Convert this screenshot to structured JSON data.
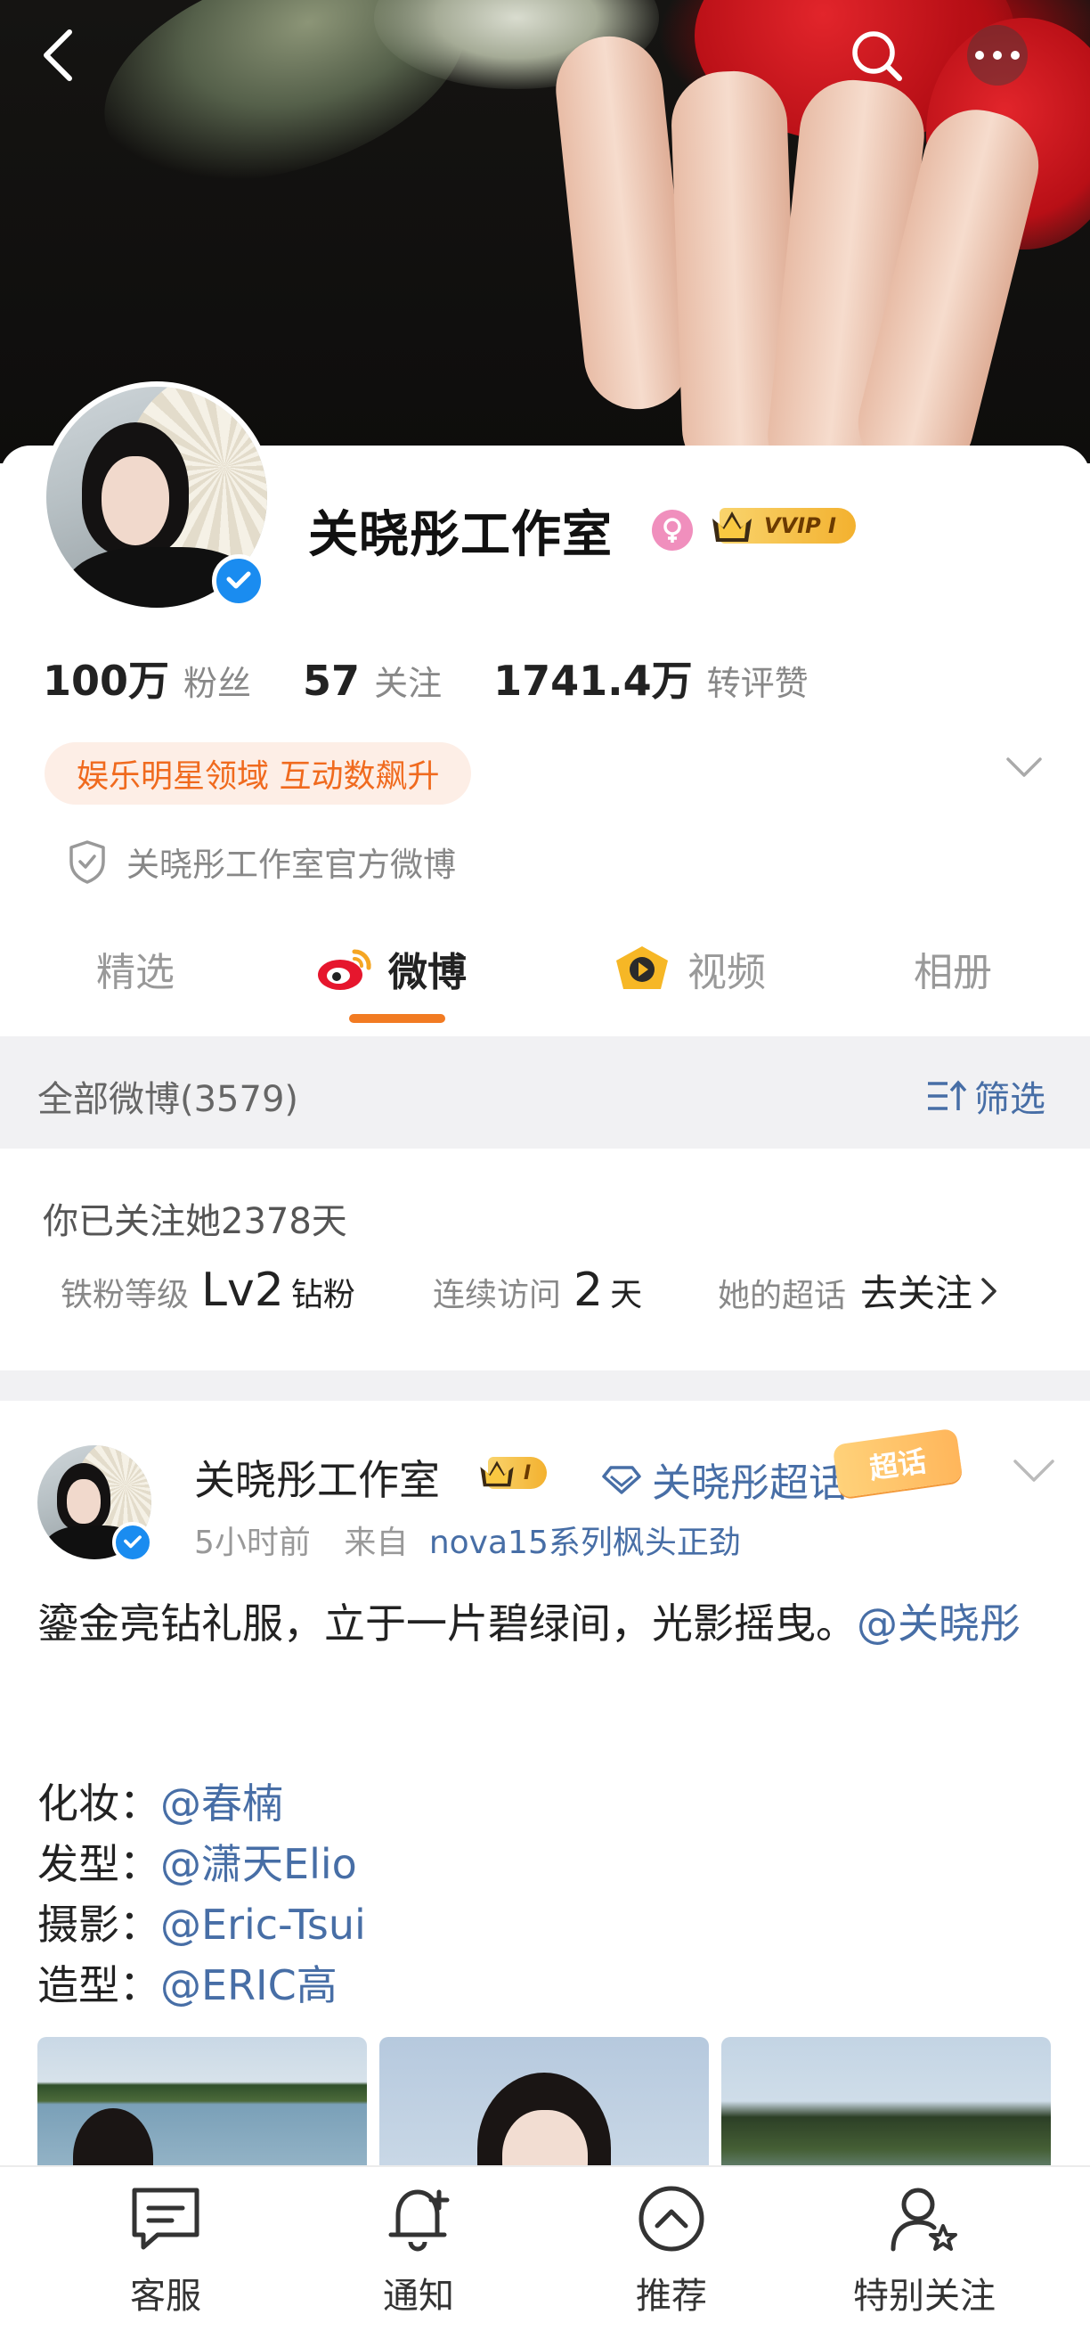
{
  "header": {
    "back_icon": "chevron-left-icon",
    "search_icon": "search-icon",
    "more_icon": "more-dots-icon"
  },
  "profile": {
    "name": "关晓彤工作室",
    "gender_icon": "female-icon",
    "vip_label": "VVIP I",
    "verified_icon": "verified-badge-icon",
    "stats": [
      {
        "value": "100万",
        "label": "粉丝"
      },
      {
        "value": "57",
        "label": "关注"
      },
      {
        "value": "1741.4万",
        "label": "转评赞"
      }
    ],
    "domain_tag": "娱乐明星领域 互动数飙升",
    "official_label": "关晓彤工作室官方微博"
  },
  "tabs": [
    {
      "label": "精选",
      "active": false
    },
    {
      "label": "微博",
      "active": true
    },
    {
      "label": "视频",
      "active": false
    },
    {
      "label": "相册",
      "active": false
    }
  ],
  "filter": {
    "all_posts": "全部微博(3579)",
    "filter_label": "筛选"
  },
  "follow_info": {
    "days_text": "你已关注她2378天",
    "fan_level_label": "铁粉等级",
    "fan_level_value": "Lv2",
    "fan_level_suffix": "钻粉",
    "visit_label": "连续访问",
    "visit_value": "2",
    "visit_suffix": "天",
    "super_label": "她的超话",
    "super_action": "去关注"
  },
  "post": {
    "author": "关晓彤工作室",
    "vip_label": "I",
    "super_topic": "关晓彤超话",
    "super_badge": "超话",
    "time": "5小时前",
    "from_prefix": "来自",
    "source": "nova15系列枫头正劲",
    "text": "鎏金亮钻礼服，立于一片碧绿间，光影摇曳。",
    "mention": "@关晓彤",
    "credits": [
      {
        "role": "化妆：",
        "name": "@春楠"
      },
      {
        "role": "发型：",
        "name": "@潇天Elio"
      },
      {
        "role": "摄影：",
        "name": "@Eric-Tsui"
      },
      {
        "role": "造型：",
        "name": "@ERIC高"
      }
    ]
  },
  "bottom_nav": [
    {
      "label": "客服",
      "icon": "chat-icon"
    },
    {
      "label": "通知",
      "icon": "bell-plus-icon"
    },
    {
      "label": "推荐",
      "icon": "recommend-icon"
    },
    {
      "label": "特别关注",
      "icon": "user-star-icon"
    }
  ],
  "colors": {
    "accent_orange": "#f27b22",
    "link_blue": "#476ea6",
    "verified_blue": "#1a8cf0",
    "vip_gold": "#f3b12f"
  }
}
